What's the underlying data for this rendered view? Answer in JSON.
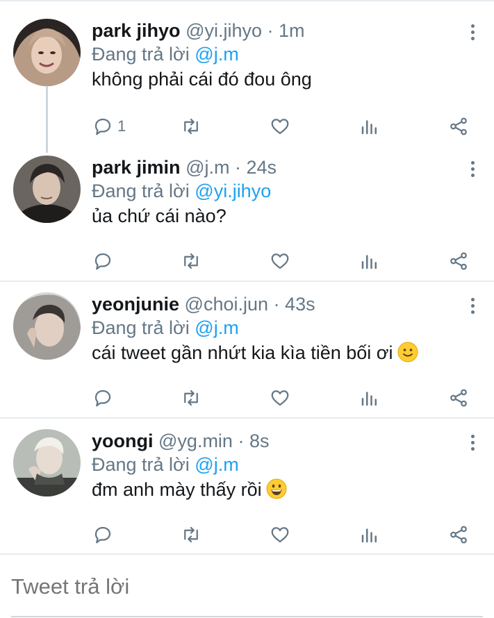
{
  "colors": {
    "accent": "#1da1f2",
    "muted": "#657786",
    "text": "#14171a",
    "divider": "#e6ecf0"
  },
  "reply_prefix": "Đang trả lời",
  "tweets": [
    {
      "name": "park jihyo",
      "handle": "@yi.jihyo",
      "time": "1m",
      "reply_to": "@j.m",
      "text": "không phải cái đó đou ông",
      "reply_count": "1",
      "emoji": ""
    },
    {
      "name": "park jimin",
      "handle": "@j.m",
      "time": "24s",
      "reply_to": "@yi.jihyo",
      "text": "ủa chứ cái nào?",
      "reply_count": "",
      "emoji": ""
    },
    {
      "name": "yeonjunie",
      "handle": "@choi.jun",
      "time": "43s",
      "reply_to": "@j.m",
      "text": "cái tweet gần nhứt kia kìa tiền bối ơi",
      "reply_count": "",
      "emoji": "slightly-smiling-face"
    },
    {
      "name": "yoongi",
      "handle": "@yg.min",
      "time": "8s",
      "reply_to": "@j.m",
      "text": "đm anh mày thấy rồi",
      "reply_count": "",
      "emoji": "grinning-face"
    }
  ],
  "composer": {
    "placeholder": "Tweet trả lời"
  }
}
